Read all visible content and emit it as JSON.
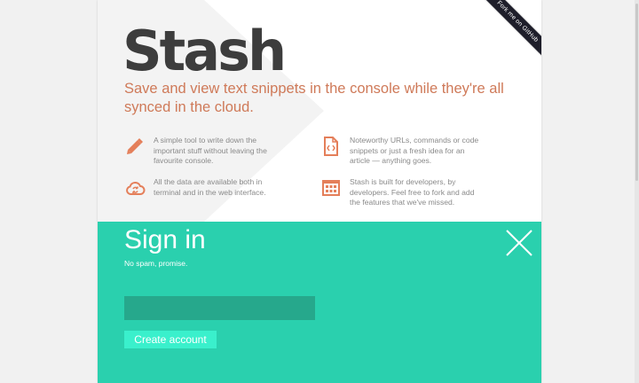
{
  "header": {
    "logo": "Stash",
    "tagline": "Save and view text snippets in the console while they're all synced in the cloud."
  },
  "ribbon": {
    "label": "Fork me on GitHub"
  },
  "features": [
    {
      "icon": "pencil-icon",
      "text": "A simple tool to write down the important stuff without leaving the favourite console."
    },
    {
      "icon": "code-file-icon",
      "text": "Noteworthy URLs, commands or code snippets or just a fresh idea for an article — anything goes."
    },
    {
      "icon": "cloud-sync-icon",
      "text": "All the data are available both in terminal and in the web interface."
    },
    {
      "icon": "calculator-icon",
      "text": "Stash is built for developers, by developers. Feel free to fork and add the features that we've missed."
    }
  ],
  "signin": {
    "title": "Sign in",
    "subtitle": "No spam, promise.",
    "email_value": "",
    "create_button": "Create account"
  },
  "colors": {
    "accent_teal": "#2ad0ae",
    "input_bg": "#26a88c",
    "button_bg": "#3af0cc",
    "tagline": "#cf7a59",
    "icon": "#e47f5a",
    "ribbon": "#1e1e2a"
  }
}
